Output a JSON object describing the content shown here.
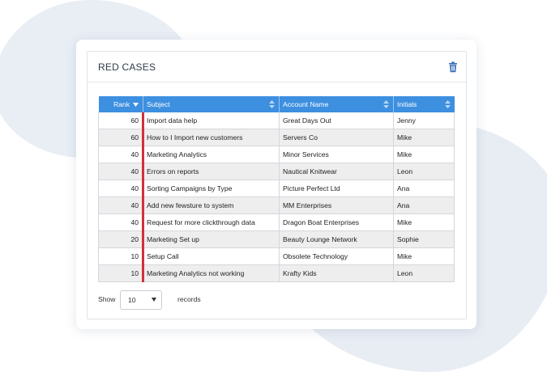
{
  "panel": {
    "title": "RED CASES"
  },
  "table": {
    "columns": [
      "Rank",
      "Subject",
      "Account Name",
      "Initials"
    ],
    "rows": [
      {
        "rank": "60",
        "subject": "Import data help",
        "account": "Great Days Out",
        "initials": "Jenny"
      },
      {
        "rank": "60",
        "subject": "How to I Import new customers",
        "account": "Servers Co",
        "initials": "Mike"
      },
      {
        "rank": "40",
        "subject": "Marketing Analytics",
        "account": "Minor Services",
        "initials": "Mike"
      },
      {
        "rank": "40",
        "subject": "Errors on reports",
        "account": "Nautical Knitwear",
        "initials": "Leon"
      },
      {
        "rank": "40",
        "subject": "Sorting Campaigns by Type",
        "account": "Picture Perfect Ltd",
        "initials": "Ana"
      },
      {
        "rank": "40",
        "subject": "Add new fewsture to system",
        "account": "MM Enterprises",
        "initials": "Ana"
      },
      {
        "rank": "40",
        "subject": "Request for more clickthrough data",
        "account": "Dragon Boat Enterprises",
        "initials": "Mike"
      },
      {
        "rank": "20",
        "subject": "Marketing Set up",
        "account": "Beauty Lounge Network",
        "initials": "Sophie"
      },
      {
        "rank": "10",
        "subject": "Setup Call",
        "account": "Obsolete Technology",
        "initials": "Mike"
      },
      {
        "rank": "10",
        "subject": "Marketing Analytics not working",
        "account": "Krafty Kids",
        "initials": "Leon"
      }
    ]
  },
  "footer": {
    "show_label": "Show",
    "page_size": "10",
    "records_label": "records"
  },
  "icons": {
    "delete": "trash-icon",
    "sort": "sort-icon",
    "sort_desc": "sort-desc-icon",
    "dropdown": "chevron-down-icon"
  },
  "colors": {
    "header": "#3d8fe0",
    "rank_marker": "#d2303a",
    "row_alt": "#eeeeee"
  }
}
